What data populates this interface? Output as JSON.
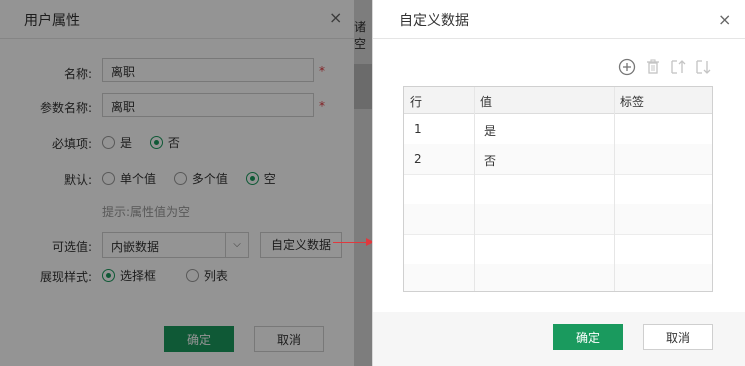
{
  "background_dialog": {
    "title": "用户属性",
    "close_glyph": "×",
    "labels": {
      "name": "名称:",
      "param_name": "参数名称:",
      "required": "必填项:",
      "default": "默认:",
      "options": "可选值:",
      "display_style": "展现样式:"
    },
    "name_value": "离职",
    "param_name_value": "离职",
    "required_mark": "*",
    "required_options": [
      {
        "label": "是",
        "selected": false
      },
      {
        "label": "否",
        "selected": true
      }
    ],
    "default_options": [
      {
        "label": "单个值",
        "selected": false
      },
      {
        "label": "多个值",
        "selected": false
      },
      {
        "label": "空",
        "selected": true
      }
    ],
    "hint": "提示:属性值为空",
    "options_select_value": "内嵌数据",
    "custom_data_button": "自定义数据",
    "display_style_options": [
      {
        "label": "选择框",
        "selected": true
      },
      {
        "label": "列表",
        "selected": false
      }
    ],
    "confirm_button": "确定",
    "cancel_button": "取消",
    "partial_glimpse_text": "诸空"
  },
  "custom_data_dialog": {
    "title": "自定义数据",
    "close_glyph": "×",
    "toolbar": [
      "add-icon",
      "delete-icon",
      "move-up-icon",
      "move-down-icon"
    ],
    "table": {
      "columns": [
        "行",
        "值",
        "标签"
      ],
      "rows": [
        [
          "1",
          "是",
          ""
        ],
        [
          "2",
          "否",
          ""
        ],
        [
          "",
          "",
          ""
        ],
        [
          "",
          "",
          ""
        ],
        [
          "",
          "",
          ""
        ],
        [
          "",
          "",
          ""
        ]
      ]
    },
    "confirm_button": "确定",
    "cancel_button": "取消"
  },
  "colors": {
    "accent": "#1a9a5e",
    "required_red": "#e0393e",
    "arrow_red": "#e0393e"
  }
}
